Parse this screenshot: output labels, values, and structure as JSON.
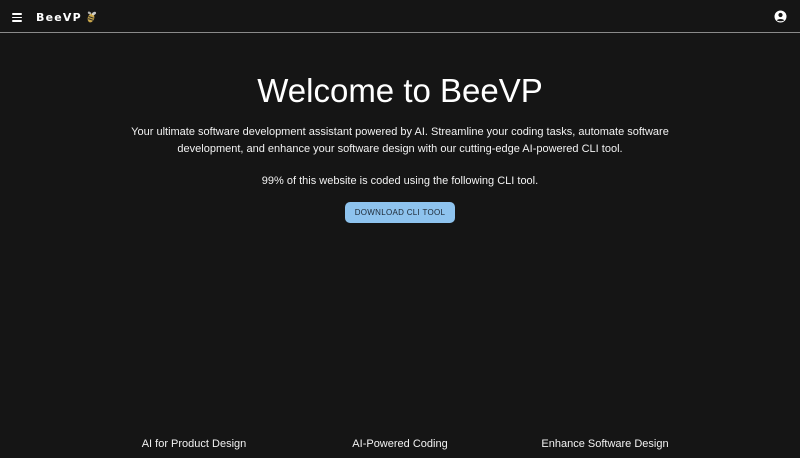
{
  "header": {
    "brand": "BeeVP",
    "menu_icon": "hamburger-menu-icon",
    "logo_icon": "bee-icon",
    "account_icon": "account-circle-icon"
  },
  "hero": {
    "title": "Welcome to BeeVP",
    "description": "Your ultimate software development assistant powered by AI. Streamline your coding tasks, automate software development, and enhance your software design with our cutting-edge AI-powered CLI tool.",
    "note": "99% of this website is coded using the following CLI tool.",
    "download_label": "DOWNLOAD CLI TOOL"
  },
  "features": [
    {
      "label": "AI for Product Design"
    },
    {
      "label": "AI-Powered Coding"
    },
    {
      "label": "Enhance Software Design"
    }
  ],
  "colors": {
    "background": "#151515",
    "button": "#8ec3ee",
    "divider": "#8a8a8a"
  }
}
